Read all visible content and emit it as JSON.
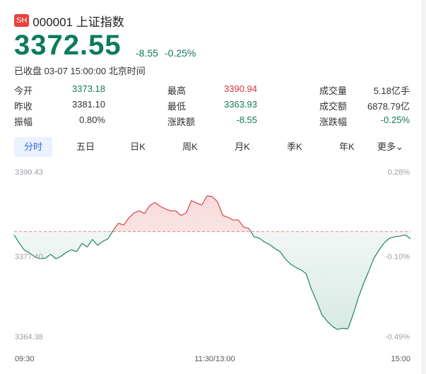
{
  "header": {
    "badge": "SH",
    "code_name": "000001 上证指数"
  },
  "quote": {
    "price": "3372.55",
    "change": "-8.55",
    "change_pct": "-0.25%",
    "status": "已收盘 03-07 15:00:00 北京时间"
  },
  "stats": [
    {
      "label": "今开",
      "value": "3373.18",
      "color": "#0e7a5d"
    },
    {
      "label": "最高",
      "value": "3390.94",
      "color": "#d9343a"
    },
    {
      "label": "成交量",
      "value": "5.18亿手",
      "color": "#333333"
    },
    {
      "label": "昨收",
      "value": "3381.10",
      "color": "#333333"
    },
    {
      "label": "最低",
      "value": "3363.93",
      "color": "#0e7a5d"
    },
    {
      "label": "成交额",
      "value": "6878.79亿",
      "color": "#333333"
    },
    {
      "label": "振幅",
      "value": "0.80%",
      "color": "#333333"
    },
    {
      "label": "涨跌额",
      "value": "-8.55",
      "color": "#0e7a5d"
    },
    {
      "label": "涨跌幅",
      "value": "-0.25%",
      "color": "#0e7a5d"
    }
  ],
  "tabs": [
    {
      "label": "分时",
      "active": true
    },
    {
      "label": "五日"
    },
    {
      "label": "日K"
    },
    {
      "label": "周K"
    },
    {
      "label": "月K"
    },
    {
      "label": "季K"
    },
    {
      "label": "年K"
    },
    {
      "label": "更多"
    }
  ],
  "colors": {
    "up": "#d9343a",
    "down": "#0e7a5d",
    "baseline": "#f08080",
    "accent": "#2f6bd9"
  },
  "chart_data": {
    "type": "line",
    "y_left_ticks": [
      "3390.43",
      "3377.40",
      "3364.38"
    ],
    "y_right_ticks": [
      "0.28%",
      "-0.10%",
      "-0.49%"
    ],
    "x_ticks": [
      "09:30",
      "11:30/13:00",
      "15:00"
    ],
    "ylim": [
      3364.38,
      3390.43
    ],
    "prev_close": 3381.1,
    "values": [
      3380.6,
      3379.3,
      3378.2,
      3377.8,
      3377.2,
      3376.9,
      3377.0,
      3377.6,
      3376.9,
      3377.3,
      3377.9,
      3378.3,
      3378.0,
      3379.3,
      3378.7,
      3379.9,
      3379.0,
      3379.6,
      3380.0,
      3381.3,
      3382.4,
      3382.1,
      3383.2,
      3384.0,
      3384.3,
      3383.9,
      3385.1,
      3385.6,
      3385.0,
      3384.6,
      3384.3,
      3384.3,
      3383.6,
      3384.0,
      3385.9,
      3385.5,
      3385.2,
      3386.6,
      3386.5,
      3385.7,
      3383.6,
      3383.3,
      3382.9,
      3382.9,
      3381.8,
      3381.6,
      3380.3,
      3380.1,
      3379.5,
      3379.1,
      3378.5,
      3378.0,
      3376.9,
      3376.1,
      3375.6,
      3375.2,
      3374.6,
      3372.2,
      3370.4,
      3368.3,
      3367.3,
      3366.5,
      3366.0,
      3366.2,
      3366.1,
      3368.3,
      3370.9,
      3373.1,
      3375.0,
      3377.0,
      3378.3,
      3379.4,
      3380.1,
      3380.3,
      3380.4,
      3380.6,
      3380.0
    ]
  }
}
